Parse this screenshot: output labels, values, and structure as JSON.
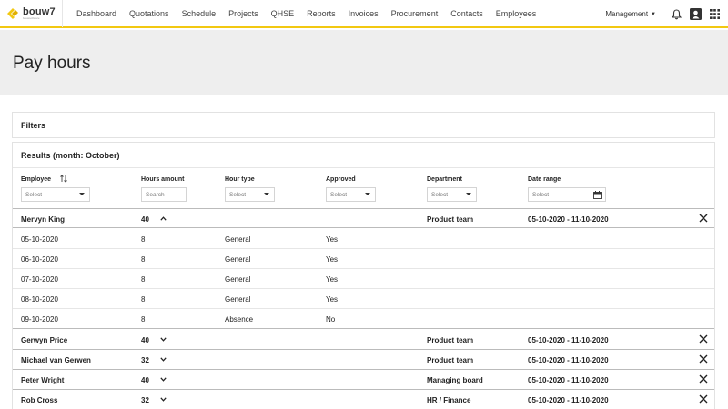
{
  "brand": {
    "name": "bouw7",
    "tagline": "bouwsoftware",
    "accent": "#f2c811"
  },
  "nav": {
    "items": [
      "Dashboard",
      "Quotations",
      "Schedule",
      "Projects",
      "QHSE",
      "Reports",
      "Invoices",
      "Procurement",
      "Contacts",
      "Employees"
    ],
    "account_menu": "Management"
  },
  "page": {
    "title": "Pay hours"
  },
  "filters": {
    "label": "Filters"
  },
  "results": {
    "label": "Results (month: October)",
    "columns": {
      "employee": "Employee",
      "hours_amount": "Hours amount",
      "hour_type": "Hour type",
      "approved": "Approved",
      "department": "Department",
      "date_range": "Date range"
    },
    "controls": {
      "employee": "Select",
      "hours_amount": "Search",
      "hour_type": "Select",
      "approved": "Select",
      "department": "Select",
      "date_range": "Select"
    },
    "groups": [
      {
        "employee": "Mervyn King",
        "hours": "40",
        "department": "Product team",
        "range": "05-10-2020 - 11-10-2020",
        "expanded": true,
        "entries": [
          {
            "date": "05-10-2020",
            "hours": "8",
            "type": "General",
            "approved": "Yes"
          },
          {
            "date": "06-10-2020",
            "hours": "8",
            "type": "General",
            "approved": "Yes"
          },
          {
            "date": "07-10-2020",
            "hours": "8",
            "type": "General",
            "approved": "Yes"
          },
          {
            "date": "08-10-2020",
            "hours": "8",
            "type": "General",
            "approved": "Yes"
          },
          {
            "date": "09-10-2020",
            "hours": "8",
            "type": "Absence",
            "approved": "No"
          }
        ]
      },
      {
        "employee": "Gerwyn Price",
        "hours": "40",
        "department": "Product team",
        "range": "05-10-2020 - 11-10-2020",
        "expanded": false
      },
      {
        "employee": "Michael van Gerwen",
        "hours": "32",
        "department": "Product team",
        "range": "05-10-2020 - 11-10-2020",
        "expanded": false
      },
      {
        "employee": "Peter Wright",
        "hours": "40",
        "department": "Managing board",
        "range": "05-10-2020 - 11-10-2020",
        "expanded": false
      },
      {
        "employee": "Rob Cross",
        "hours": "32",
        "department": "HR / Finance",
        "range": "05-10-2020 - 11-10-2020",
        "expanded": false
      }
    ]
  }
}
